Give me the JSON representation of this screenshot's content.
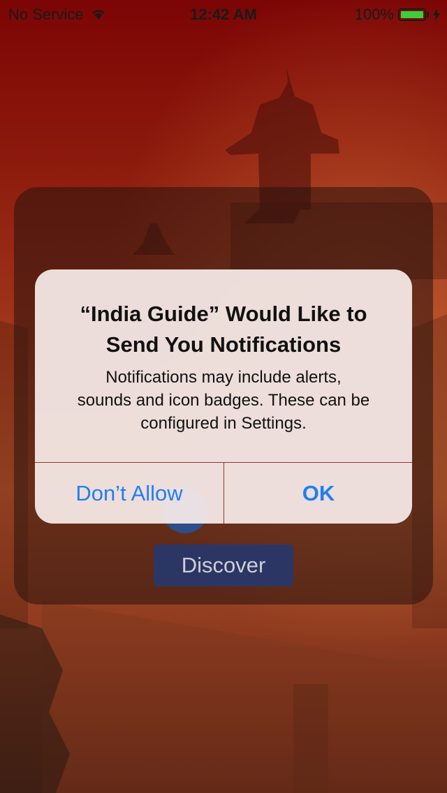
{
  "status_bar": {
    "carrier": "No Service",
    "time": "12:42 AM",
    "battery": "100%"
  },
  "background": {
    "discover_label": "Discover"
  },
  "alert": {
    "title_line1": "“India Guide” Would Like to",
    "title_line2": "Send You Notifications",
    "message_line1": "Notifications may include alerts,",
    "message_line2": "sounds and icon badges. These can be",
    "message_line3": "configured in Settings.",
    "deny_label": "Don’t Allow",
    "allow_label": "OK"
  },
  "colors": {
    "accent": "#1f7ff2",
    "battery": "#3cce3c"
  }
}
